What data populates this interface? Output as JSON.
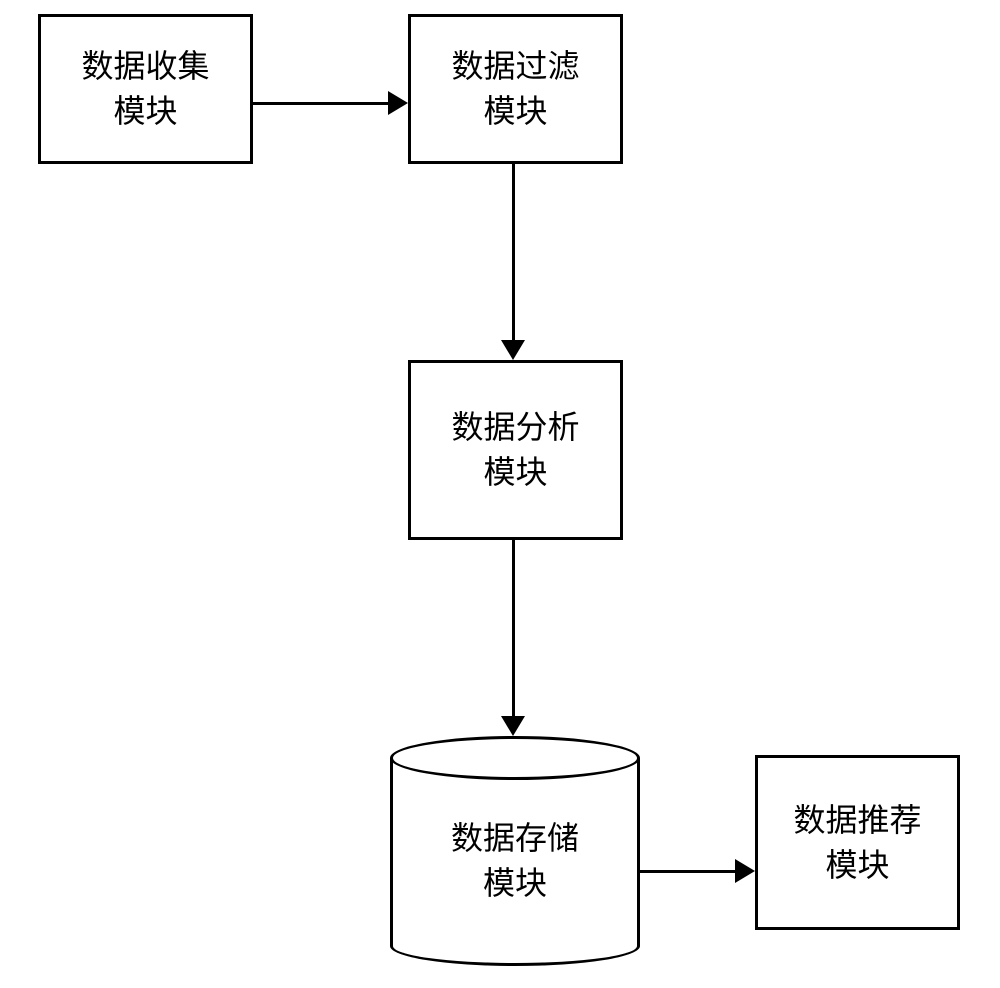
{
  "diagram": {
    "data_collection": {
      "line1": "数据收集",
      "line2": "模块"
    },
    "data_filter": {
      "line1": "数据过滤",
      "line2": "模块"
    },
    "data_analysis": {
      "line1": "数据分析",
      "line2": "模块"
    },
    "data_storage": {
      "line1": "数据存储",
      "line2": "模块"
    },
    "data_recommend": {
      "line1": "数据推荐",
      "line2": "模块"
    }
  }
}
